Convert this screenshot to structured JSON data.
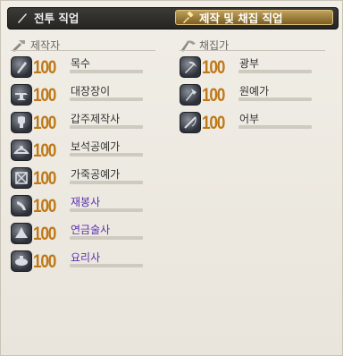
{
  "tabs": [
    {
      "label": "전투 직업",
      "icon": "sword-icon",
      "active": false
    },
    {
      "label": "제작 및 채집 직업",
      "icon": "hammer-icon",
      "active": true
    }
  ],
  "sections": {
    "crafters": {
      "title": "제작자",
      "icon": "crafter-tools-icon",
      "jobs": [
        {
          "level": "100",
          "name": "목수",
          "icon": "carpenter-icon",
          "highlight": false,
          "xp": 0.0
        },
        {
          "level": "100",
          "name": "대장장이",
          "icon": "blacksmith-icon",
          "highlight": false,
          "xp": 0.0
        },
        {
          "level": "100",
          "name": "갑주제작사",
          "icon": "armorer-icon",
          "highlight": false,
          "xp": 0.0
        },
        {
          "level": "100",
          "name": "보석공예가",
          "icon": "goldsmith-icon",
          "highlight": false,
          "xp": 0.0
        },
        {
          "level": "100",
          "name": "가죽공예가",
          "icon": "leatherworker-icon",
          "highlight": false,
          "xp": 0.0
        },
        {
          "level": "100",
          "name": "재봉사",
          "icon": "weaver-icon",
          "highlight": true,
          "xp": 0.0
        },
        {
          "level": "100",
          "name": "연금술사",
          "icon": "alchemist-icon",
          "highlight": true,
          "xp": 0.0
        },
        {
          "level": "100",
          "name": "요리사",
          "icon": "culinarian-icon",
          "highlight": true,
          "xp": 0.0
        }
      ]
    },
    "gatherers": {
      "title": "채집가",
      "icon": "gatherer-tools-icon",
      "jobs": [
        {
          "level": "100",
          "name": "광부",
          "icon": "pickaxe-icon",
          "highlight": false,
          "xp": 0.0
        },
        {
          "level": "100",
          "name": "원예가",
          "icon": "hatchet-icon",
          "highlight": false,
          "xp": 0.0
        },
        {
          "level": "100",
          "name": "어부",
          "icon": "fishing-rod-icon",
          "highlight": false,
          "xp": 0.0
        }
      ]
    }
  },
  "colors": {
    "level": "#bf7817",
    "special_name": "#5b2fb0",
    "tab_active": "#a88640"
  }
}
